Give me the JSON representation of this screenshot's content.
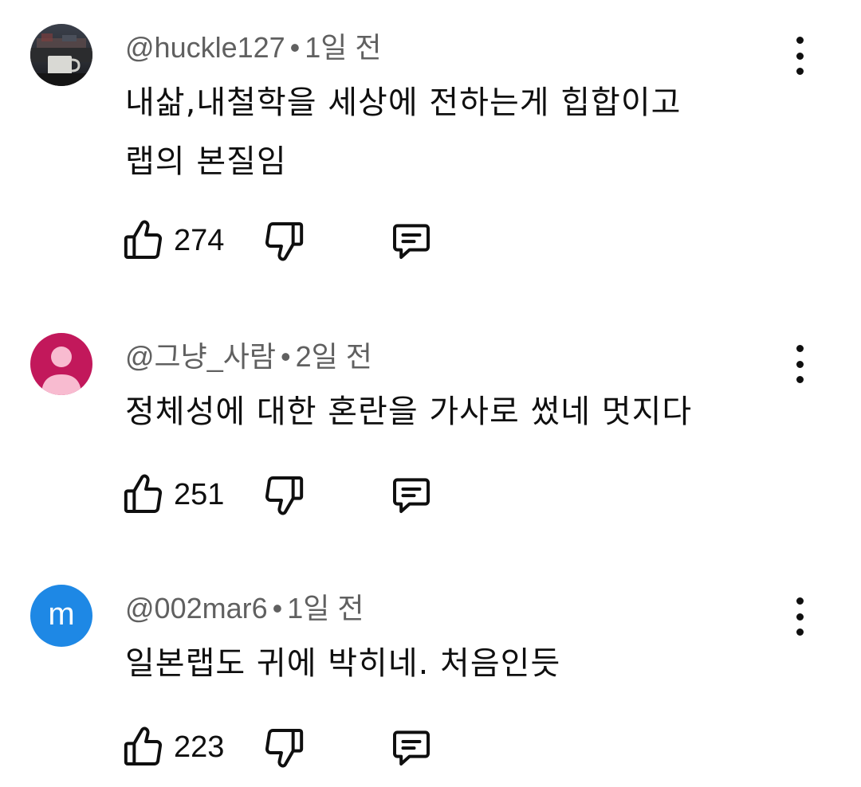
{
  "comments": [
    {
      "handle": "@huckle127",
      "separator": "•",
      "time": "1일 전",
      "lines": [
        "내삶,내철학을 세상에 전하는게 힙합이고",
        "랩의 본질임"
      ],
      "likes": "274",
      "avatar_type": "photo"
    },
    {
      "handle": "@그냥_사람",
      "separator": "•",
      "time": "2일 전",
      "lines": [
        "정체성에 대한 혼란을 가사로 썼네 멋지다"
      ],
      "likes": "251",
      "avatar_type": "default-person",
      "avatar_color": "#c2185b"
    },
    {
      "handle": "@002mar6",
      "separator": "•",
      "time": "1일 전",
      "lines": [
        "일본랩도 귀에 박히네. 처음인듯"
      ],
      "likes": "223",
      "avatar_type": "letter",
      "avatar_letter": "m",
      "avatar_color": "#1e88e5"
    }
  ],
  "icons": {
    "like": "thumbs-up-icon",
    "dislike": "thumbs-down-icon",
    "reply": "reply-comment-icon",
    "menu": "more-vertical-icon"
  }
}
